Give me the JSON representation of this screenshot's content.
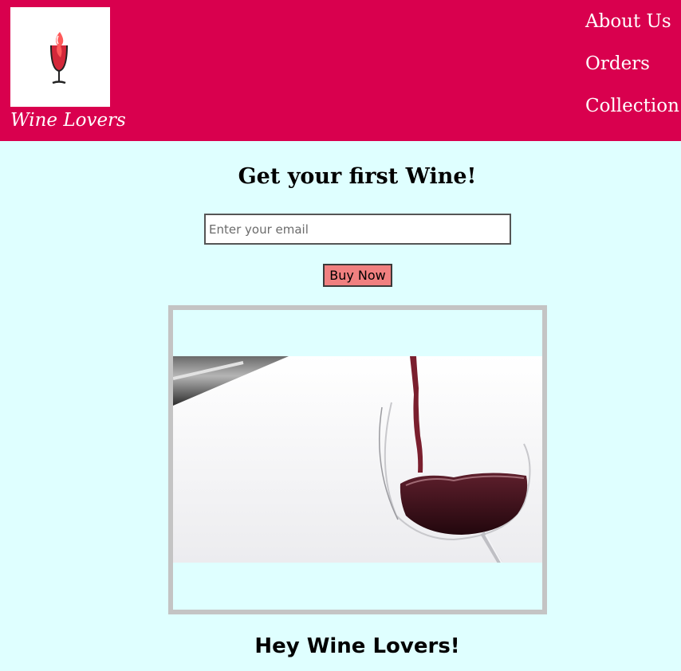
{
  "brand": {
    "name": "Wine Lovers",
    "logo_icon": "wine-glass-icon"
  },
  "nav": {
    "items": [
      {
        "label": "About Us"
      },
      {
        "label": "Orders"
      },
      {
        "label": "Collection"
      }
    ]
  },
  "hero": {
    "title": "Get your first Wine!",
    "email_placeholder": "Enter your email",
    "buy_label": "Buy Now"
  },
  "media": {
    "image_name": "wine-pouring-image"
  },
  "section": {
    "heading": "Hey Wine Lovers!"
  },
  "colors": {
    "header": "#d9004e",
    "page_bg": "#dfffff",
    "button": "#f08080",
    "frame": "#c4c4c4"
  }
}
